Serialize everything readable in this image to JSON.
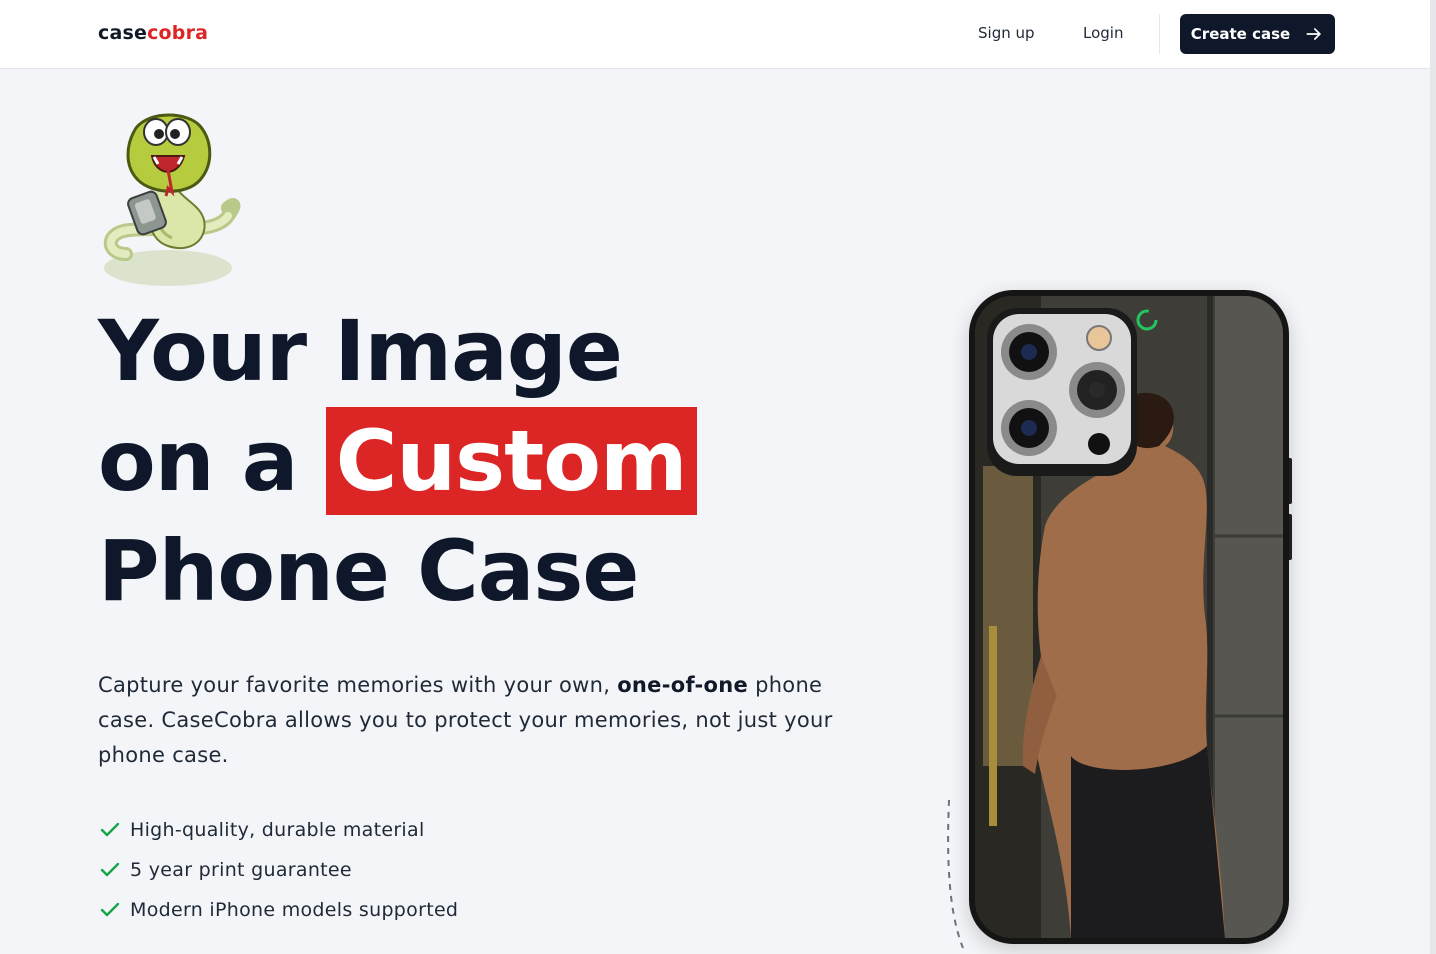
{
  "nav": {
    "logo_part1": "case",
    "logo_part2": "cobra",
    "signup": "Sign up",
    "login": "Login",
    "create_case": "Create case"
  },
  "hero": {
    "line1": "Your Image",
    "line2_prefix": "on a",
    "line2_highlight": "Custom",
    "line3": "Phone Case",
    "lead_part1": "Capture your favorite memories with your own,",
    "lead_bold": "one-of-one",
    "lead_part2": "phone case. CaseCobra allows you to protect your memories, not just your phone case."
  },
  "features": [
    "High-quality, durable material",
    "5 year print guarantee",
    "Modern iPhone models supported"
  ],
  "colors": {
    "brand_red": "#dc2626",
    "dark": "#0f172a",
    "check_green": "#16a34a"
  },
  "icons": {
    "cta": "arrow-right-icon",
    "feature": "check-icon"
  }
}
